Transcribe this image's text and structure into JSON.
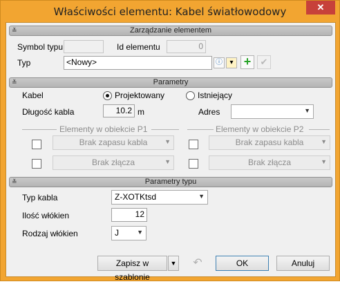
{
  "window": {
    "title": "Właściwości elementu: Kabel światłowodowy",
    "close_glyph": "✕"
  },
  "sections": {
    "manage": "Zarządzanie elementem",
    "params": "Parametry",
    "type_params": "Parametry typu",
    "collapse_glyph": "≚"
  },
  "manage": {
    "symbol_label": "Symbol typu",
    "symbol_value": "",
    "id_label": "Id elementu",
    "id_value": "0",
    "typ_label": "Typ",
    "typ_value": "<Nowy>"
  },
  "params": {
    "kabel_label": "Kabel",
    "radio_projected": "Projektowany",
    "radio_existing": "Istniejący",
    "selected": "Projektowany",
    "length_label": "Długość kabla",
    "length_value": "10.2",
    "length_unit": "m",
    "address_label": "Adres",
    "address_value": "",
    "p1_label": "Elementy w obiekcie P1",
    "p2_label": "Elementy w obiekcie P2",
    "p1_reserve": "Brak zapasu kabla",
    "p1_joint": "Brak złącza",
    "p2_reserve": "Brak zapasu kabla",
    "p2_joint": "Brak złącza"
  },
  "type_params": {
    "cable_type_label": "Typ kabla",
    "cable_type_value": "Z-XOTKtsd",
    "fiber_count_label": "Ilość włókien",
    "fiber_count_value": "12",
    "fiber_kind_label": "Rodzaj włókien",
    "fiber_kind_value": "J"
  },
  "footer": {
    "save_template": "Zapisz w szablonie",
    "ok": "OK",
    "cancel": "Anuluj"
  },
  "icons": {
    "dropdown": "▼",
    "undo": "↶",
    "add": "+",
    "apply": "✔"
  }
}
